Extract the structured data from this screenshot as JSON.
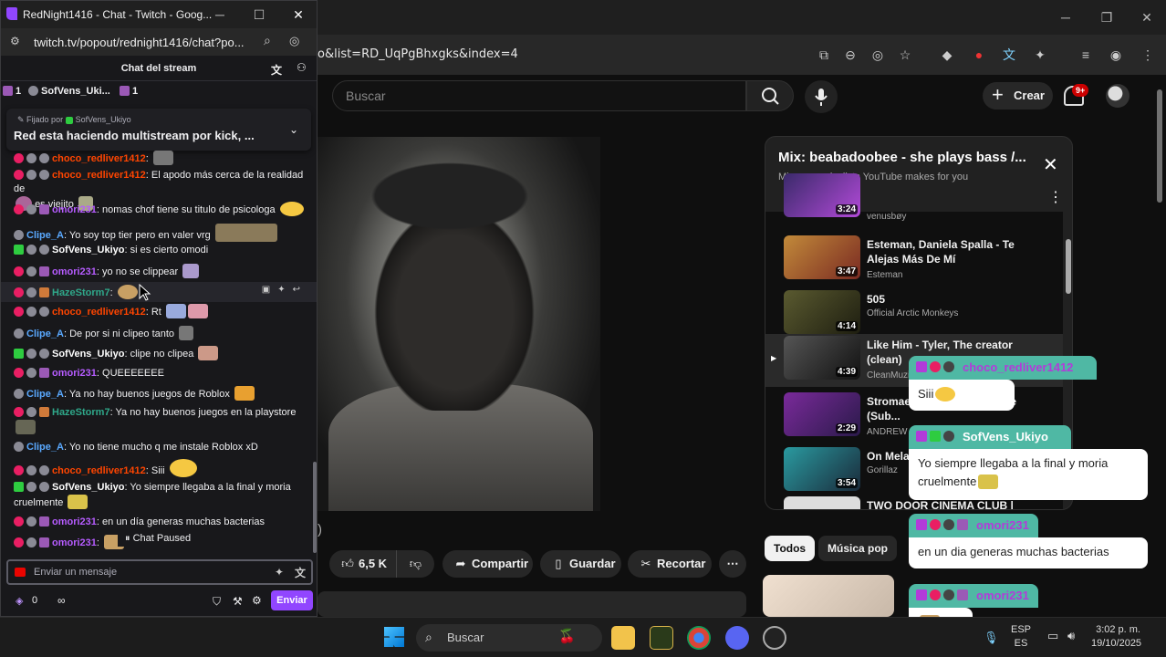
{
  "youtube_browser": {
    "url": "o&list=RD_UqPgBhxgks&index=4",
    "search_placeholder": "Buscar",
    "create_label": "Crear",
    "notif_count": "9+",
    "actions": {
      "like_count": "6,5 K",
      "share": "Compartir",
      "save": "Guardar",
      "clip": "Recortar",
      "more": "⋯"
    },
    "playlist": {
      "title": "Mix: beabadoobee - she plays bass /...",
      "subtitle": "Mixes are playlists YouTube makes for you",
      "items": [
        {
          "title": "",
          "channel": "venusbøy",
          "duration": "3:24"
        },
        {
          "title": "Esteman, Daniela Spalla - Te Alejas Más De Mí",
          "channel": "Esteman",
          "duration": "3:47"
        },
        {
          "title": "505",
          "channel": "Official Arctic Monkeys",
          "duration": "4:14"
        },
        {
          "title": "Like Him - Tyler, The creator (clean)",
          "channel": "CleanMuzi",
          "duration": "4:39"
        },
        {
          "title": "Stromae - Meilleure Ennemie (Sub...",
          "channel": "ANDREW I",
          "duration": "2:29"
        },
        {
          "title": "On Melan",
          "channel": "Gorillaz",
          "duration": "3:54"
        },
        {
          "title": "TWO DOOR CINEMA CLUB |",
          "channel": "",
          "duration": ""
        }
      ]
    },
    "chips": [
      "Todos",
      "Música pop"
    ],
    "paren": ")"
  },
  "overlay_bubbles": [
    {
      "user": "choco_redliver1412",
      "message": "Siii"
    },
    {
      "user": "SofVens_Ukiyo",
      "message": "Yo siempre llegaba a la final y moria cruelmente"
    },
    {
      "user": "omori231",
      "message": "en un dia generas muchas bacterias"
    },
    {
      "user": "omori231",
      "message": ""
    }
  ],
  "twitch": {
    "window_title": "RedNight1416 - Chat - Twitch - Goog...",
    "url": "twitch.tv/popout/rednight1416/chat?po...",
    "header_title": "Chat del stream",
    "gift_bar": {
      "count1": "1",
      "user": "SofVens_Uki...",
      "count2": "1"
    },
    "pinned": {
      "by_prefix": "Fijado por",
      "by_user": "SofVens_Ukiyo",
      "message": "Red esta haciendo multistream por kick, ..."
    },
    "messages": [
      {
        "user": "choco_redliver1412",
        "text": "",
        "color": "#ff4500"
      },
      {
        "user": "choco_redliver1412",
        "text": "El apodo más cerca de la realidad de",
        "cont": "es viejito",
        "color": "#ff4500"
      },
      {
        "user": "omori231",
        "text": "nomas chof tiene su titulo de psicologa",
        "color": "#b65cff"
      },
      {
        "user": "Clipe_A",
        "text": "Yo soy top tier pero en valer vrg",
        "color": "#5aa9ff"
      },
      {
        "user": "SofVens_Ukiyo",
        "text": "si es cierto omodi",
        "color": "#ffffff"
      },
      {
        "user": "omori231",
        "text": "yo no se clippear",
        "color": "#b65cff"
      },
      {
        "user": "HazeStorm7",
        "text": "",
        "color": "#2fa88a"
      },
      {
        "user": "choco_redliver1412",
        "text": "Rt",
        "color": "#ff4500"
      },
      {
        "user": "Clipe_A",
        "text": "De por si ni clipeo tanto",
        "color": "#5aa9ff"
      },
      {
        "user": "SofVens_Ukiyo",
        "text": "clipe no clipea",
        "color": "#ffffff"
      },
      {
        "user": "omori231",
        "text": "QUEEEEEEE",
        "color": "#b65cff"
      },
      {
        "user": "Clipe_A",
        "text": "Ya no hay buenos juegos de Roblox",
        "color": "#5aa9ff"
      },
      {
        "user": "HazeStorm7",
        "text": "Ya no hay buenos juegos en la playstore",
        "color": "#2fa88a"
      },
      {
        "user": "Clipe_A",
        "text": "Yo no tiene mucho q me instale Roblox xD",
        "color": "#5aa9ff"
      },
      {
        "user": "choco_redliver1412",
        "text": "Siii",
        "color": "#ff4500"
      },
      {
        "user": "SofVens_Ukiyo",
        "text": "Yo siempre llegaba a la final y moria",
        "cont": "cruelmente",
        "color": "#ffffff"
      },
      {
        "user": "omori231",
        "text": "en un día generas muchas bacterias",
        "color": "#b65cff"
      },
      {
        "user": "omori231",
        "text": "",
        "color": "#b65cff"
      }
    ],
    "chat_paused": "Chat Paused",
    "input_placeholder": "Enviar un mensaje",
    "points": "0",
    "infinity": "∞",
    "send_label": "Enviar"
  },
  "taskbar": {
    "search": "Buscar",
    "lang_top": "ESP",
    "lang_bottom": "ES",
    "time": "3:02 p. m.",
    "date": "19/10/2025"
  }
}
